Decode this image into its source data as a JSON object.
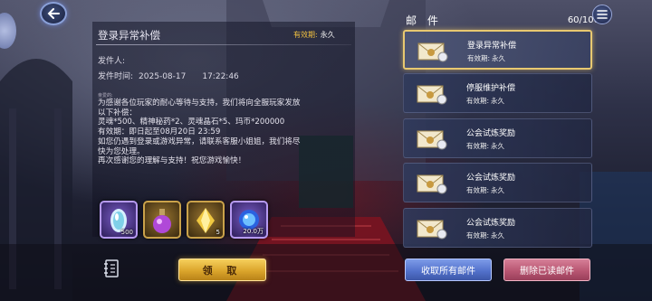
{
  "header": {
    "mail_title": "邮 件",
    "mail_count": "60/100"
  },
  "detail": {
    "title": "登录异常补偿",
    "validity_label": "有效期:",
    "validity_value": "永久",
    "sender_label": "发件人:",
    "send_time_label": "发件时间:",
    "send_date": "2025-08-17",
    "send_clock": "17:22:46",
    "greeting": "亲爱的:",
    "body_lines": [
      "为感谢各位玩家的耐心等待与支持，我们将向全服玩家发放",
      "以下补偿：",
      "灵魂*500、精神秘药*2、灵魂晶石*5、玛币*200000",
      "有效期：即日起至08月20日 23:59",
      "如您仍遇到登录或游戏异常，请联系客服小姐姐，我们将尽",
      "快为您处理。",
      "再次感谢您的理解与支持！祝您游戏愉快！"
    ]
  },
  "rewards": [
    {
      "name": "soul-crystal",
      "qty": "500",
      "frame": "purple"
    },
    {
      "name": "spirit-potion",
      "qty": "",
      "frame": "gold"
    },
    {
      "name": "soul-gem",
      "qty": "5",
      "frame": "gold"
    },
    {
      "name": "ma-coin",
      "qty": "20.0万",
      "frame": "purple"
    }
  ],
  "buttons": {
    "claim": "领 取",
    "claim_all": "收取所有邮件",
    "delete_read": "删除已读邮件"
  },
  "mail_items": [
    {
      "subject": "登录异常补偿",
      "exp_label": "有效期:",
      "exp_value": "永久",
      "selected": true
    },
    {
      "subject": "停服维护补偿",
      "exp_label": "有效期:",
      "exp_value": "永久",
      "selected": false
    },
    {
      "subject": "公会试炼奖励",
      "exp_label": "有效期:",
      "exp_value": "永久",
      "selected": false
    },
    {
      "subject": "公会试炼奖励",
      "exp_label": "有效期:",
      "exp_value": "永久",
      "selected": false
    },
    {
      "subject": "公会试炼奖励",
      "exp_label": "有效期:",
      "exp_value": "永久",
      "selected": false
    }
  ],
  "colors": {
    "accent_gold": "#f0c040",
    "claim_button": "#dba52c",
    "claim_all_button": "#5372cc",
    "delete_button": "#b85672",
    "selected_border": "#e8c870"
  }
}
